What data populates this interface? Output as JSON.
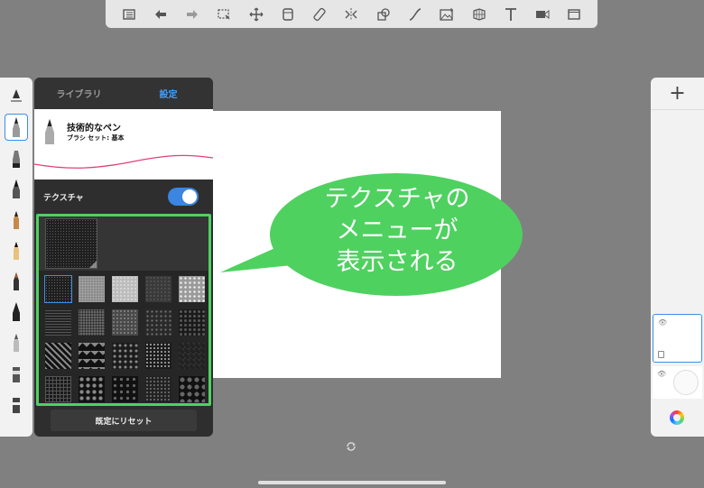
{
  "toolbar": {
    "icons": [
      "list-icon",
      "undo-icon",
      "redo-icon",
      "selection-icon",
      "transform-icon",
      "layer-stack-icon",
      "ruler-icon",
      "symmetry-icon",
      "shape-icon",
      "curve-icon",
      "image-icon",
      "perspective-icon",
      "text-icon",
      "video-icon",
      "fullscreen-icon"
    ]
  },
  "brush_panel": {
    "tabs": [
      {
        "label": "ライブラリ",
        "active": false
      },
      {
        "label": "設定",
        "active": true
      }
    ],
    "brush_name": "技術的なペン",
    "brush_set": "ブラシ セット: 基本",
    "stroke_color": "#e0407a",
    "texture_label": "テクスチャ",
    "texture_enabled": true,
    "reset_label": "既定にリセット",
    "highlight_color": "#4fd160"
  },
  "callout": {
    "lines": [
      "テクスチャの",
      "メニューが",
      "表示される"
    ],
    "color": "#4fd160"
  },
  "layers": {
    "add_label": "+",
    "count": 2
  }
}
